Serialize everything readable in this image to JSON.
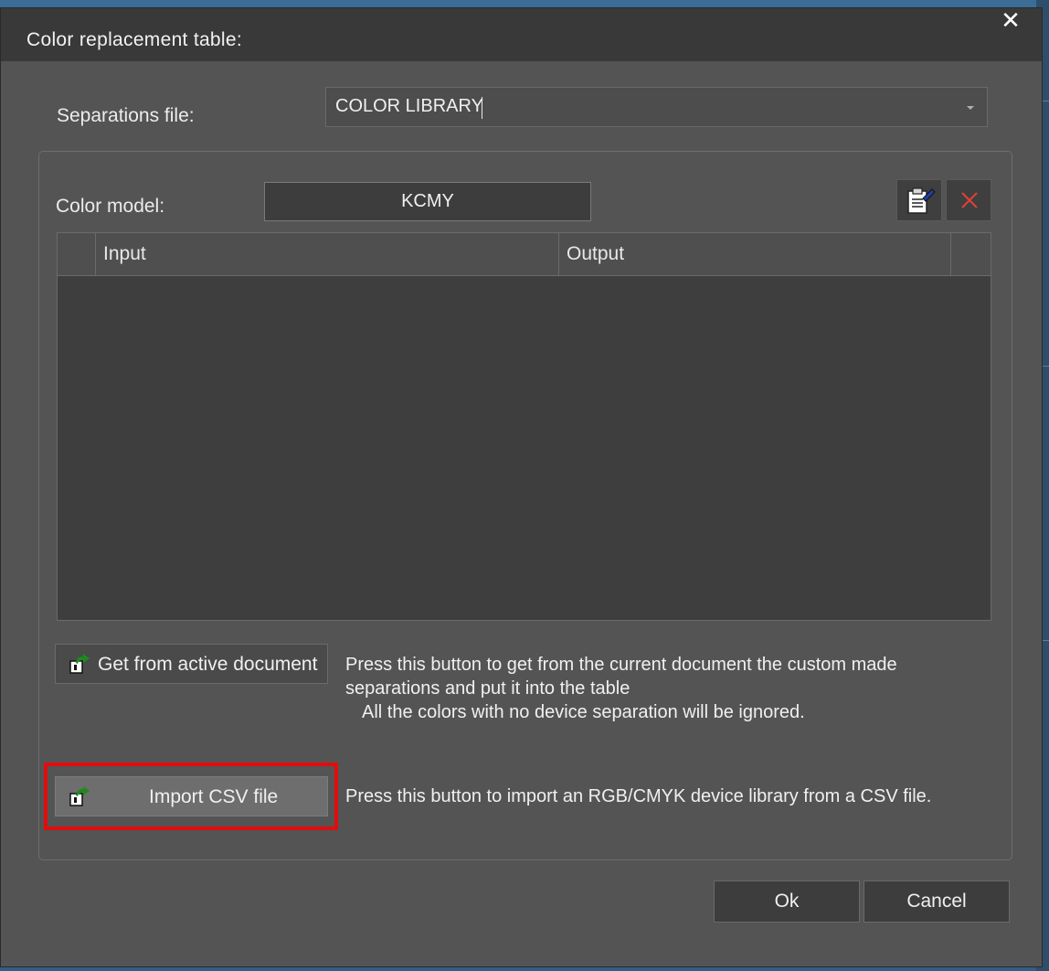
{
  "dialog": {
    "title": "Color replacement table:",
    "close_glyph": "✕"
  },
  "separations": {
    "label": "Separations file:",
    "value": "COLOR LIBRARY"
  },
  "color_model": {
    "label": "Color model:",
    "value": "KCMY"
  },
  "toolbar": {
    "edit_icon": "clipboard-edit-icon",
    "delete_icon": "delete-x-icon",
    "delete_color": "#e0403a"
  },
  "table": {
    "columns": [
      "Input",
      "Output"
    ],
    "rows": []
  },
  "get_from_document": {
    "button_label": "Get from active document",
    "description_line1": "Press this button to get from the current document the custom made",
    "description_line2": "separations and put it into the table",
    "description_line3": "All the colors with no device separation will be ignored."
  },
  "import_csv": {
    "button_label": "Import CSV file",
    "description": "Press this button to import an RGB/CMYK device library from a CSV file.",
    "highlight_color": "#e10d0d"
  },
  "footer": {
    "ok_label": "Ok",
    "cancel_label": "Cancel"
  }
}
